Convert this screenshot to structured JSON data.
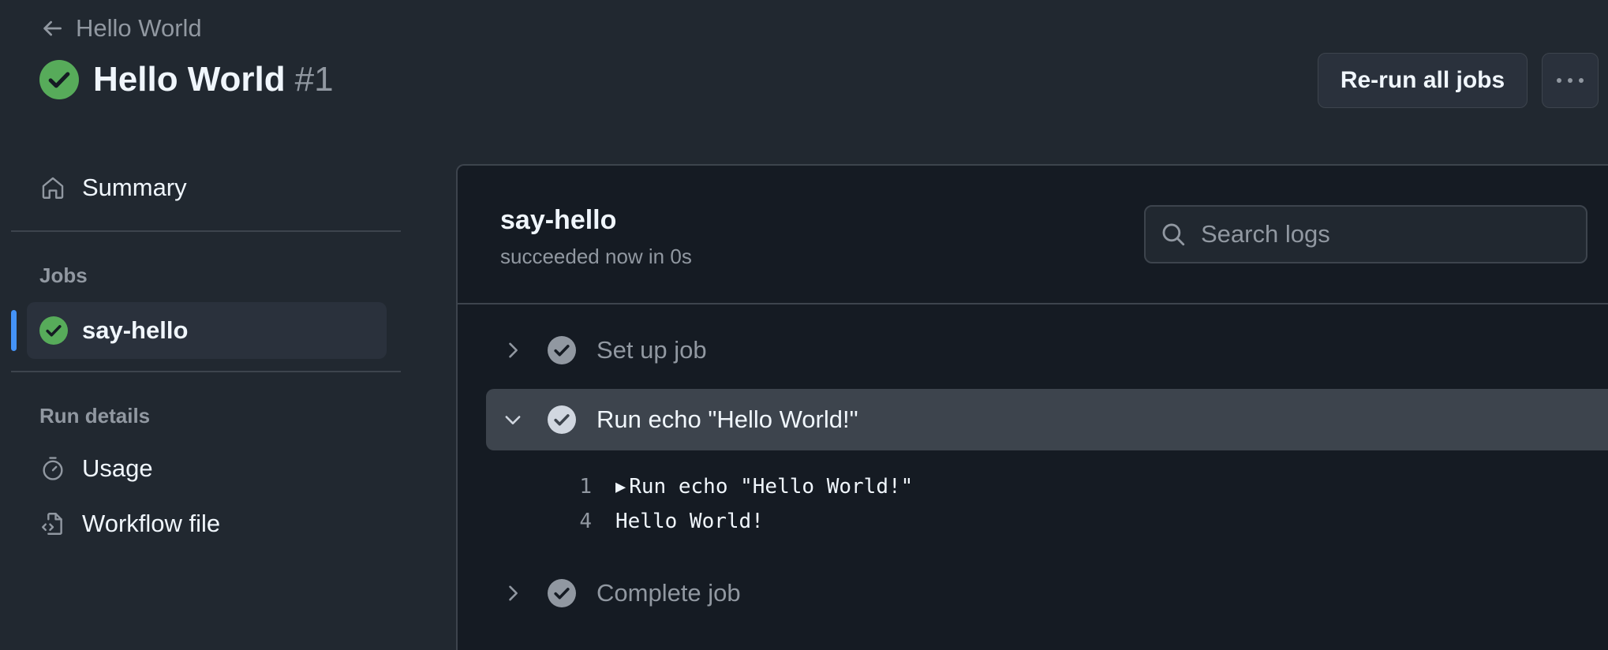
{
  "header": {
    "back_label": "Hello World",
    "run_title": "Hello World",
    "run_number": "#1",
    "rerun_label": "Re-run all jobs"
  },
  "sidebar": {
    "summary_label": "Summary",
    "jobs_heading": "Jobs",
    "job_label": "say-hello",
    "run_details_heading": "Run details",
    "usage_label": "Usage",
    "workflow_label": "Workflow file"
  },
  "job": {
    "name": "say-hello",
    "status": "succeeded now in 0s",
    "search_placeholder": "Search logs"
  },
  "steps": [
    {
      "label": "Set up job",
      "expanded": false
    },
    {
      "label": "Run echo \"Hello World!\"",
      "expanded": true
    },
    {
      "label": "Complete job",
      "expanded": false
    }
  ],
  "logs": [
    {
      "num": "1",
      "text": "Run echo \"Hello World!\"",
      "group": true
    },
    {
      "num": "4",
      "text": "Hello World!",
      "group": false
    }
  ],
  "colors": {
    "background": "#212830",
    "panel": "#151b23",
    "success": "#57ab5a",
    "accent": "#4493f8",
    "muted": "#9198a1"
  },
  "icons": {
    "back": "arrow-left-icon",
    "status": "check-circle-icon",
    "more": "kebab-horizontal-icon",
    "summary": "home-icon",
    "usage": "stopwatch-icon",
    "workflow": "file-code-icon",
    "search": "search-icon",
    "collapsed": "chevron-right-icon",
    "expanded": "chevron-down-icon"
  }
}
